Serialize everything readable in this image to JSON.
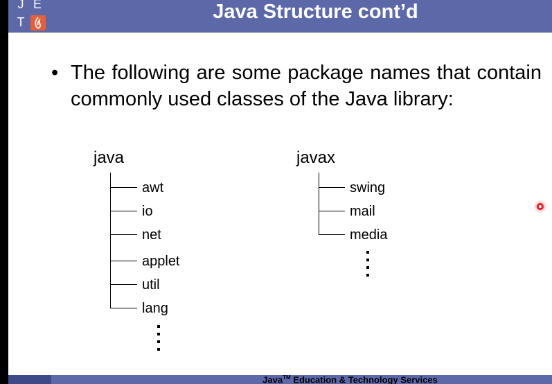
{
  "header": {
    "title": "Java Structure cont’d",
    "logo_letters": [
      "J",
      "E",
      "T"
    ]
  },
  "bullet": {
    "marker": "•",
    "text": "The following are some package names that contain commonly used classes of the Java library:"
  },
  "tree_java": {
    "root": "java",
    "items": [
      "awt",
      "io",
      "net",
      "applet",
      "util",
      "lang"
    ],
    "continuation": "⋮"
  },
  "tree_javax": {
    "root": "javax",
    "items": [
      "swing",
      "mail",
      "media"
    ],
    "continuation": "⋮"
  },
  "footer": {
    "text_pre": "Java",
    "text_sup": "TM",
    "text_post": " Education & Technology Services"
  },
  "colors": {
    "header_bg": "#5c68a8",
    "logo_accent": "#e2603b",
    "pointer": "#e0202a"
  }
}
